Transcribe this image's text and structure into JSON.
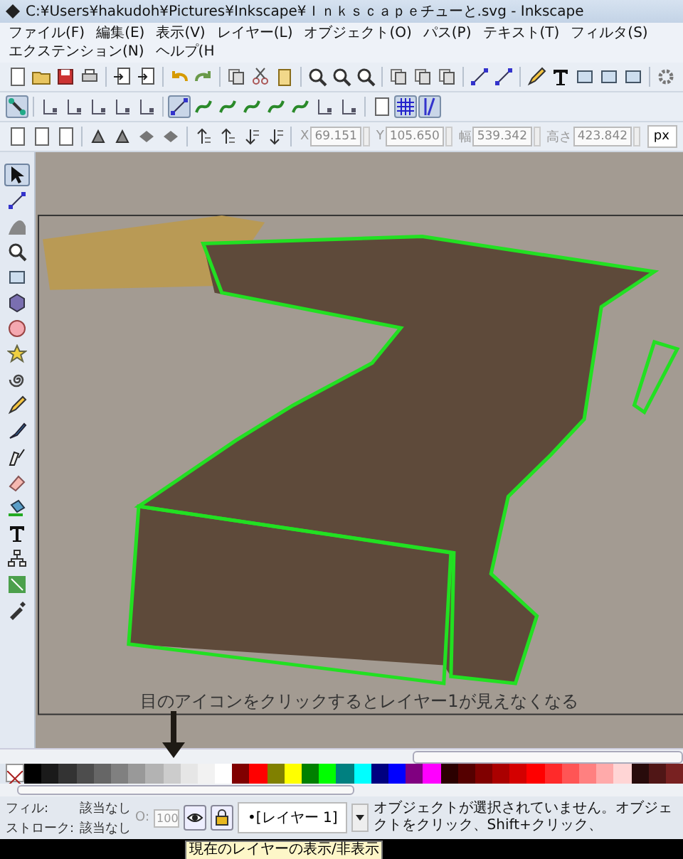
{
  "window": {
    "title": "C:¥Users¥hakudoh¥Pictures¥Inkscape¥Ｉｎｋｓｃａｐｅチューと.svg - Inkscape"
  },
  "menu": [
    "ファイル(F)",
    "編集(E)",
    "表示(V)",
    "レイヤー(L)",
    "オブジェクト(O)",
    "パス(P)",
    "テキスト(T)",
    "フィルタ(S)",
    "エクステンション(N)",
    "ヘルプ(H"
  ],
  "snap_toolbar": [
    {
      "kind": "snap",
      "on": true
    },
    {
      "kind": "bbox",
      "on": false
    },
    {
      "kind": "bbox",
      "on": false
    },
    {
      "kind": "bbox",
      "on": false
    },
    {
      "kind": "bbox",
      "on": false
    },
    {
      "kind": "bbox",
      "on": false
    },
    {
      "kind": "node",
      "on": true
    },
    {
      "kind": "path",
      "on": false
    },
    {
      "kind": "path",
      "on": false
    },
    {
      "kind": "path",
      "on": false
    },
    {
      "kind": "path",
      "on": false
    },
    {
      "kind": "path",
      "on": false
    },
    {
      "kind": "bbox",
      "on": false
    },
    {
      "kind": "bbox",
      "on": false
    },
    {
      "kind": "page",
      "on": false
    },
    {
      "kind": "grid",
      "on": true
    },
    {
      "kind": "guide",
      "on": true
    }
  ],
  "transform_fields": [
    {
      "label": "X",
      "value": "69.151"
    },
    {
      "label": "Y",
      "value": "105.650"
    },
    {
      "label": "幅",
      "value": "539.342"
    },
    {
      "label": "高さ",
      "value": "423.842"
    }
  ],
  "unit": "px",
  "tools": [
    {
      "kind": "selector",
      "selected": true
    },
    {
      "kind": "node",
      "selected": false
    },
    {
      "kind": "tweak",
      "selected": false
    },
    {
      "kind": "zoom",
      "selected": false
    },
    {
      "kind": "rect",
      "selected": false
    },
    {
      "kind": "box3d",
      "selected": false
    },
    {
      "kind": "ellipse",
      "selected": false
    },
    {
      "kind": "star",
      "selected": false
    },
    {
      "kind": "spiral",
      "selected": false
    },
    {
      "kind": "pencil",
      "selected": false
    },
    {
      "kind": "pen",
      "selected": false
    },
    {
      "kind": "calligraphy",
      "selected": false
    },
    {
      "kind": "eraser",
      "selected": false
    },
    {
      "kind": "bucket",
      "selected": false
    },
    {
      "kind": "text",
      "selected": false
    },
    {
      "kind": "connector",
      "selected": false
    },
    {
      "kind": "gradient",
      "selected": false
    },
    {
      "kind": "dropper",
      "selected": false
    }
  ],
  "caption": "目のアイコンをクリックするとレイヤー1が見えなくなる",
  "palette": [
    {
      "color": "#000000"
    },
    {
      "color": "#1a1a1a"
    },
    {
      "color": "#333333"
    },
    {
      "color": "#4d4d4d"
    },
    {
      "color": "#666666"
    },
    {
      "color": "#808080"
    },
    {
      "color": "#999999"
    },
    {
      "color": "#b3b3b3"
    },
    {
      "color": "#cccccc"
    },
    {
      "color": "#e6e6e6"
    },
    {
      "color": "#f2f2f2"
    },
    {
      "color": "#ffffff"
    },
    {
      "color": "#800000"
    },
    {
      "color": "#ff0000"
    },
    {
      "color": "#808000"
    },
    {
      "color": "#ffff00"
    },
    {
      "color": "#008000"
    },
    {
      "color": "#00ff00"
    },
    {
      "color": "#008080"
    },
    {
      "color": "#00ffff"
    },
    {
      "color": "#000080"
    },
    {
      "color": "#0000ff"
    },
    {
      "color": "#800080"
    },
    {
      "color": "#ff00ff"
    },
    {
      "color": "#2b0000"
    },
    {
      "color": "#550000"
    },
    {
      "color": "#800000"
    },
    {
      "color": "#aa0000"
    },
    {
      "color": "#d40000"
    },
    {
      "color": "#ff0000"
    },
    {
      "color": "#ff2a2a"
    },
    {
      "color": "#ff5555"
    },
    {
      "color": "#ff8080"
    },
    {
      "color": "#ffaaaa"
    },
    {
      "color": "#ffd5d5"
    },
    {
      "color": "#280b0b"
    },
    {
      "color": "#501616"
    },
    {
      "color": "#782121"
    }
  ],
  "status": {
    "fill_label": "フィル:",
    "fill_value": "該当なし",
    "stroke_label": "ストローク:",
    "stroke_value": "該当なし",
    "opacity_label": "O:",
    "opacity_value": "100",
    "layer": "•[レイヤー 1]",
    "message": "オブジェクトが選択されていません。オブジェクトをクリック、Shift+クリック、"
  },
  "tooltip": "現在のレイヤーの表示/非表示"
}
